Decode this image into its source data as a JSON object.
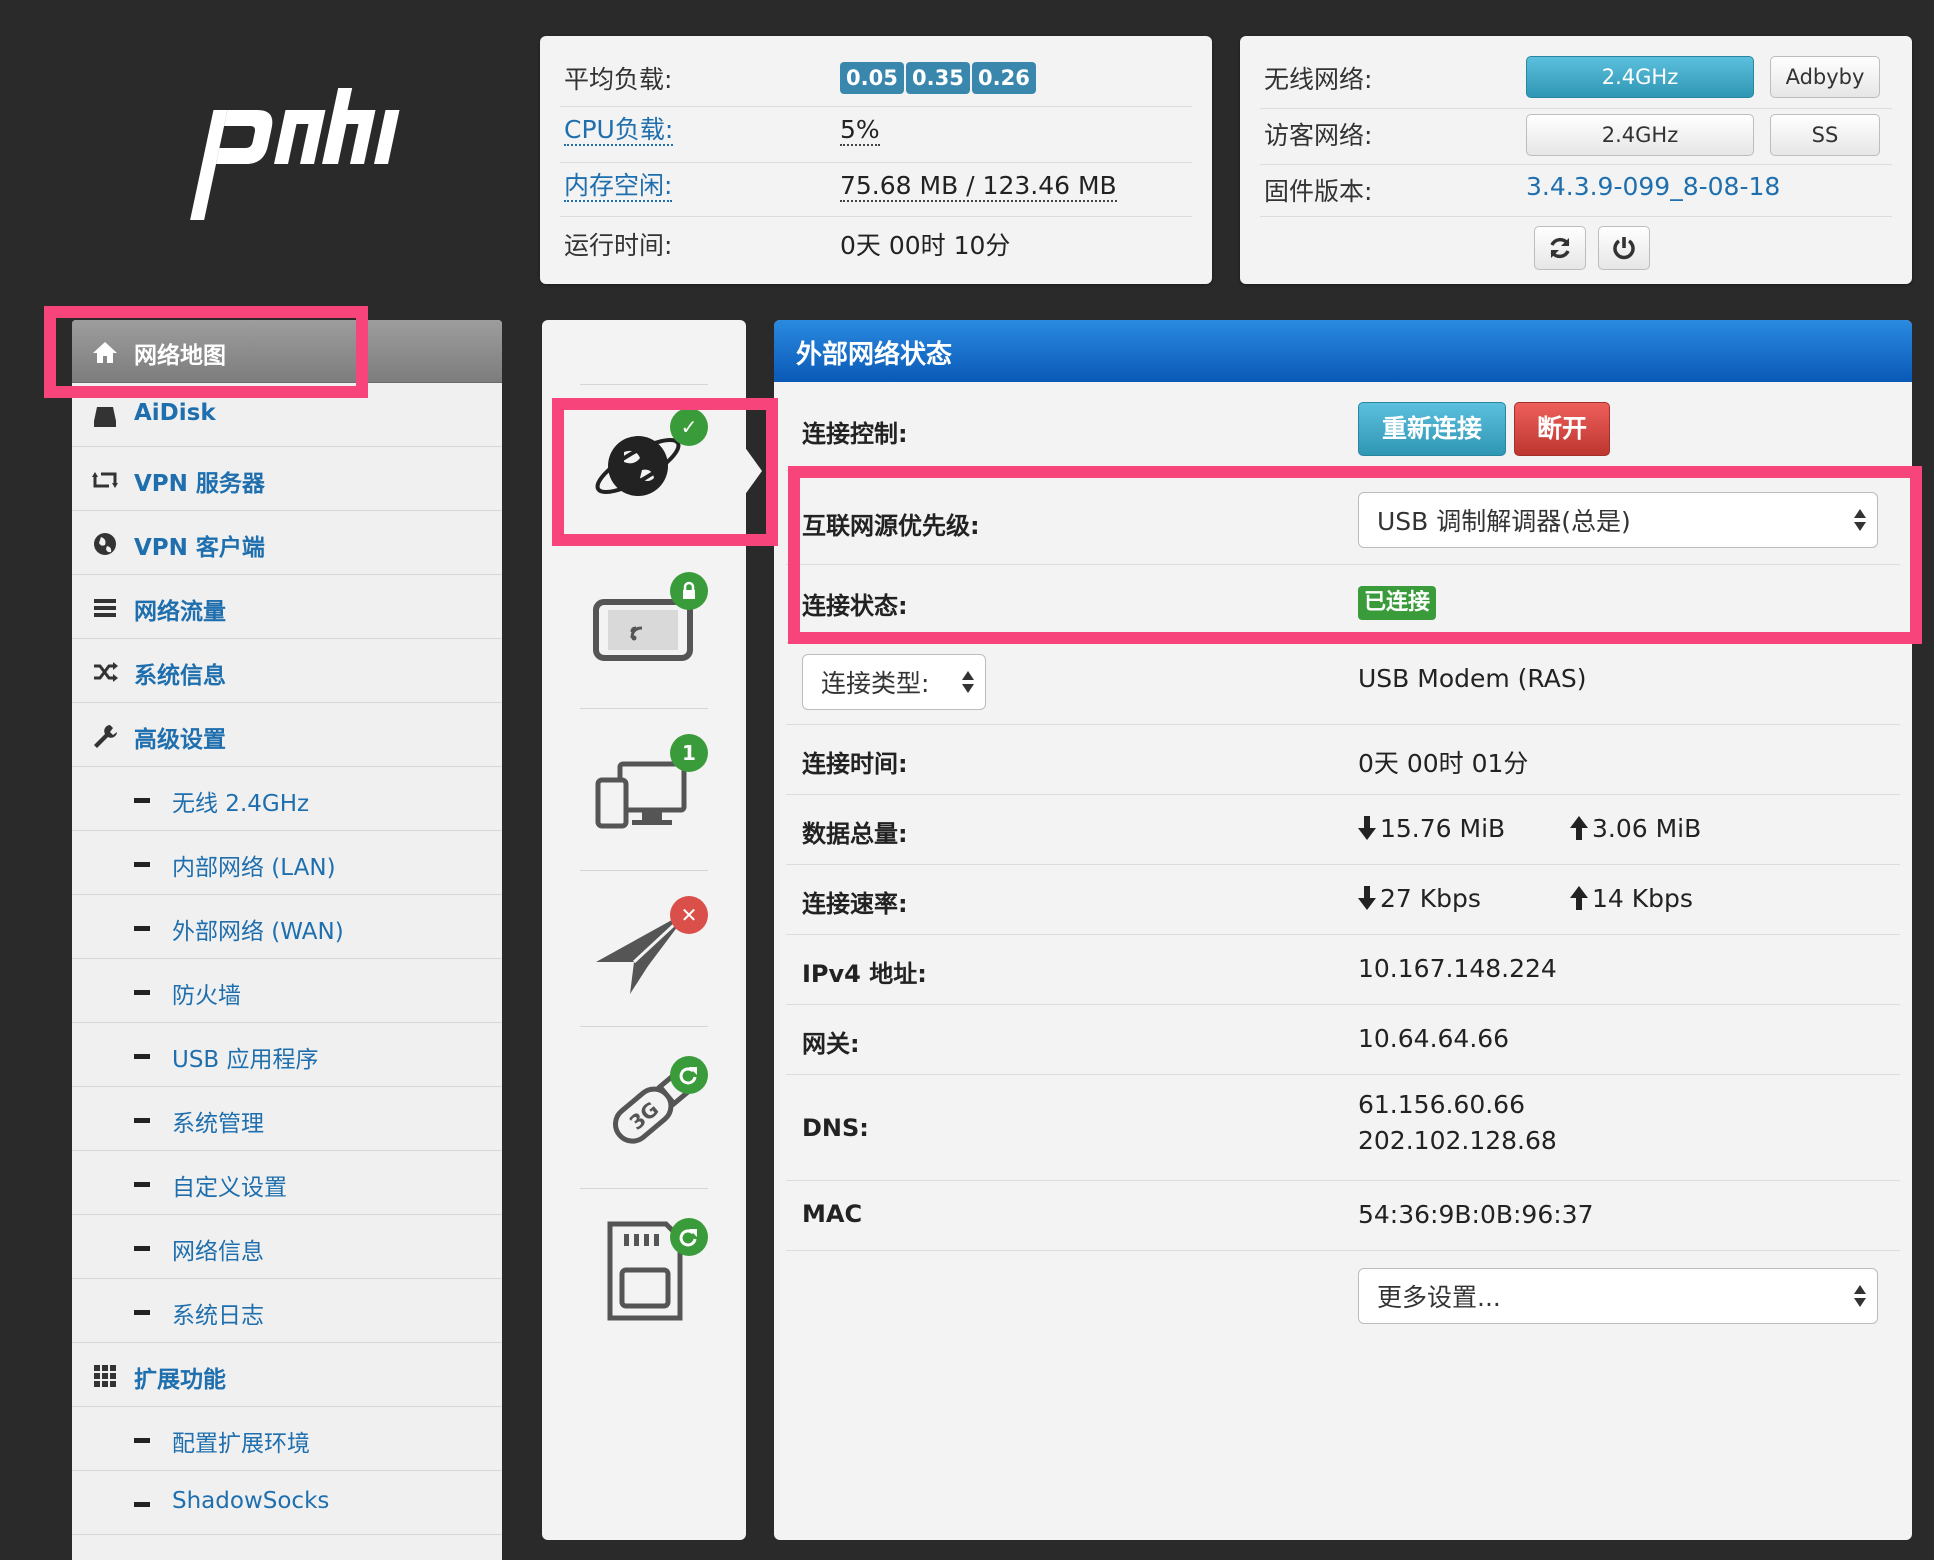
{
  "logo": {
    "text": "padavan"
  },
  "status": {
    "load_label": "平均负载:",
    "load_values": [
      "0.05",
      "0.35",
      "0.26"
    ],
    "cpu_label": "CPU负载:",
    "cpu_value": "5%",
    "mem_label": "内存空闲:",
    "mem_value": "75.68 MB / 123.46 MB",
    "uptime_label": "运行时间:",
    "uptime_value": "0天 00时 10分"
  },
  "wifi": {
    "wireless_label": "无线网络:",
    "wireless_btn": "2.4GHz",
    "adbyby_btn": "Adbyby",
    "guest_label": "访客网络:",
    "guest_btn": "2.4GHz",
    "ss_btn": "SS",
    "fw_label": "固件版本:",
    "fw_value": "3.4.3.9-099_8-08-18"
  },
  "menu": {
    "items": [
      {
        "label": "网络地图"
      },
      {
        "label": "AiDisk"
      },
      {
        "label": "VPN 服务器"
      },
      {
        "label": "VPN 客户端"
      },
      {
        "label": "网络流量"
      },
      {
        "label": "系统信息"
      },
      {
        "label": "高级设置"
      },
      {
        "label": "无线 2.4GHz"
      },
      {
        "label": "内部网络 (LAN)"
      },
      {
        "label": "外部网络 (WAN)"
      },
      {
        "label": "防火墙"
      },
      {
        "label": "USB 应用程序"
      },
      {
        "label": "系统管理"
      },
      {
        "label": "自定义设置"
      },
      {
        "label": "网络信息"
      },
      {
        "label": "系统日志"
      },
      {
        "label": "扩展功能"
      },
      {
        "label": "配置扩展环境"
      },
      {
        "label": "ShadowSocks"
      }
    ]
  },
  "icons": {
    "clients_count": "1"
  },
  "wan": {
    "title": "外部网络状态",
    "control_label": "连接控制:",
    "reconnect_btn": "重新连接",
    "disconnect_btn": "断开",
    "priority_label": "互联网源优先级:",
    "priority_value": "USB 调制解调器(总是)",
    "status_label": "连接状态:",
    "status_value": "已连接",
    "type_select": "连接类型:",
    "type_value": "USB Modem (RAS)",
    "time_label": "连接时间:",
    "time_value": "0天 00时 01分",
    "data_label": "数据总量:",
    "data_down": "15.76 MiB",
    "data_up": "3.06 MiB",
    "rate_label": "连接速率:",
    "rate_down": "27 Kbps",
    "rate_up": "14 Kbps",
    "ipv4_label": "IPv4 地址:",
    "ipv4_value": "10.167.148.224",
    "gw_label": "网关:",
    "gw_value": "10.64.64.66",
    "dns_label": "DNS:",
    "dns_values": [
      "61.156.60.66",
      "202.102.128.68"
    ],
    "mac_label": "MAC",
    "mac_value": "54:36:9B:0B:96:37",
    "more_select": "更多设置..."
  },
  "colors": {
    "accent": "#1f6fae",
    "header_blue": "#0a59b7",
    "success": "#3a9b3a",
    "danger": "#da4f49",
    "highlight": "#f7457b"
  }
}
